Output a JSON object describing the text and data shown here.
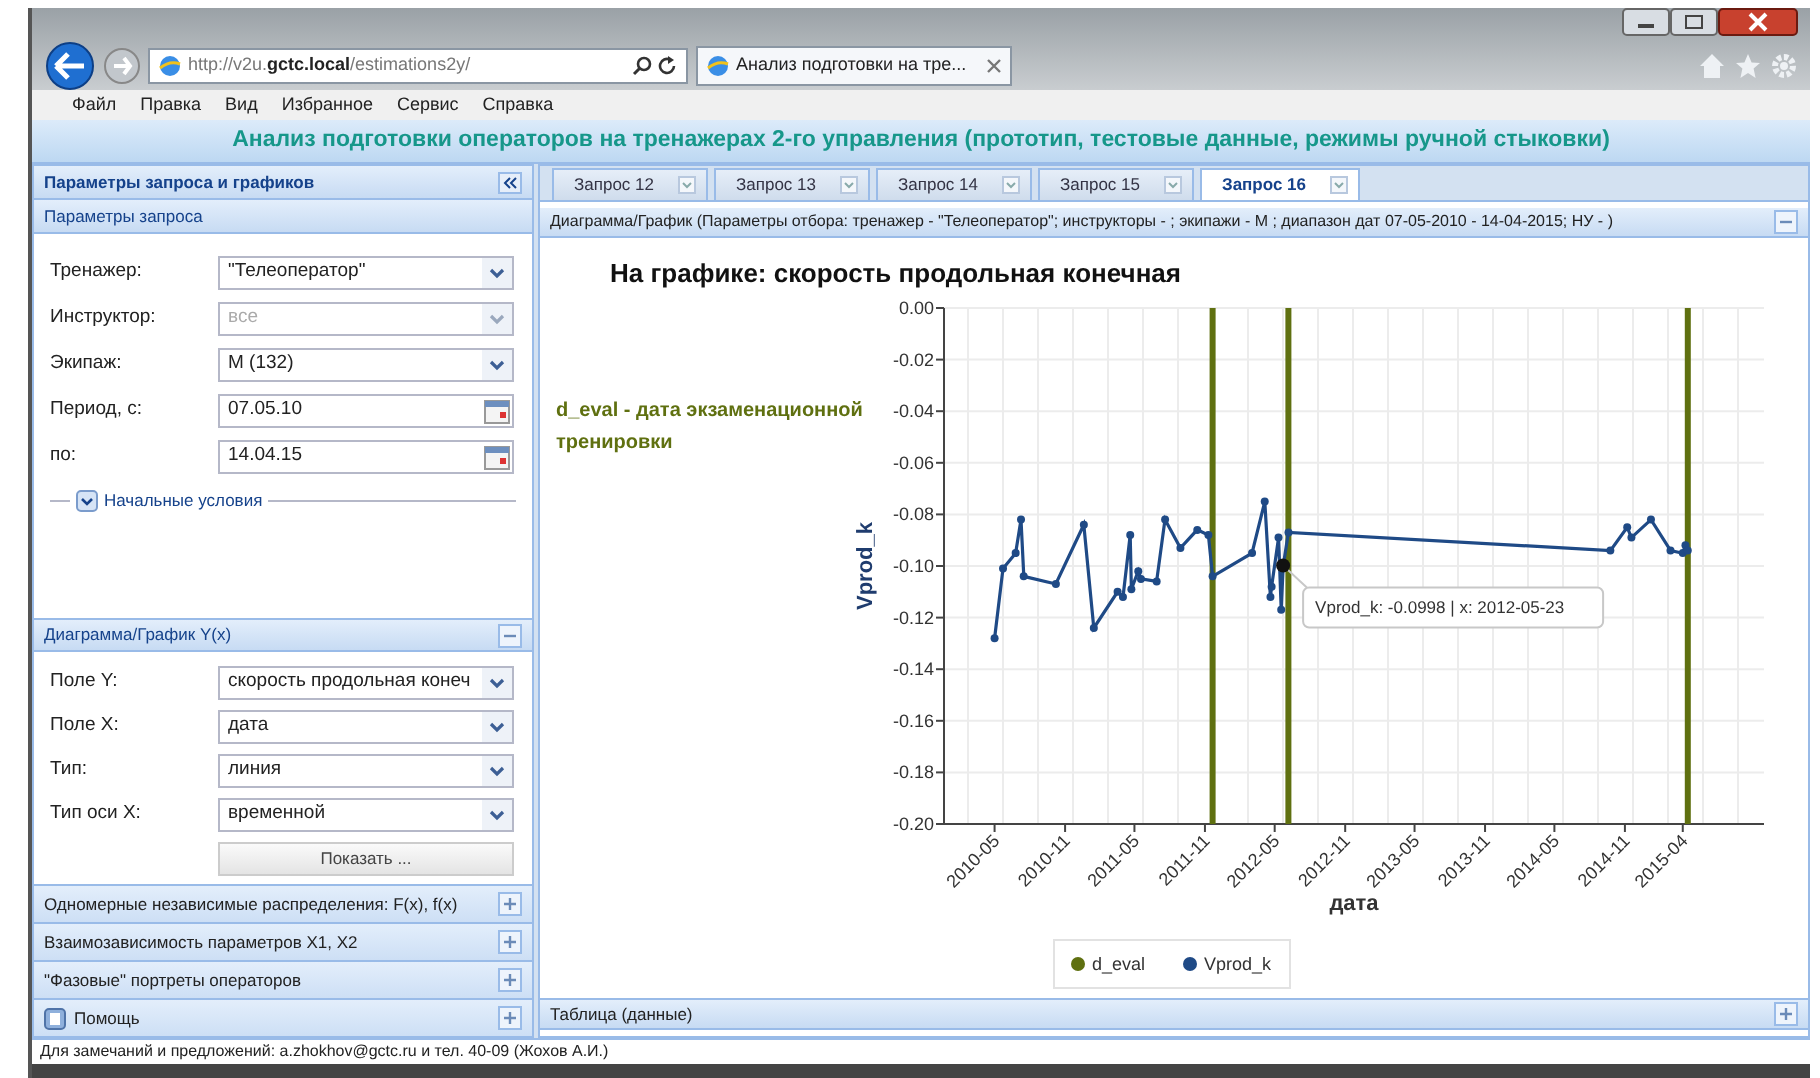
{
  "browser": {
    "address": "http://v2u.**gctc.local**/estimations2y/",
    "tab_title": "Анализ подготовки на тре...",
    "menu": [
      "Файл",
      "Правка",
      "Вид",
      "Избранное",
      "Сервис",
      "Справка"
    ]
  },
  "app_title": "Анализ подготовки операторов на тренажерах 2-го управления (прототип, тестовые данные, режимы ручной стыковки)",
  "left_panel": {
    "title": "Параметры запроса и графиков",
    "query_section": {
      "title": "Параметры запроса",
      "fields": [
        {
          "label": "Тренажер:",
          "value": "\"Телеоператор\"",
          "kind": "select",
          "disabled": false
        },
        {
          "label": "Инструктор:",
          "value": "все",
          "kind": "select",
          "disabled": true
        },
        {
          "label": "Экипаж:",
          "value": "М (132)",
          "kind": "select",
          "disabled": false
        },
        {
          "label": "Период, с:",
          "value": "07.05.10",
          "kind": "date",
          "disabled": false
        },
        {
          "label": "по:",
          "value": "14.04.15",
          "kind": "date",
          "disabled": false
        }
      ],
      "fieldset": {
        "legend": "Начальные условия",
        "expanded": false
      }
    },
    "chart_section": {
      "title": "Диаграмма/График Y(x)",
      "expanded": true,
      "fields": [
        {
          "label": "Поле Y:",
          "value": "скорость продольная конеч",
          "kind": "select",
          "disabled": false
        },
        {
          "label": "Поле X:",
          "value": "дата",
          "kind": "select",
          "disabled": false
        },
        {
          "label": "Тип:",
          "value": "линия",
          "kind": "select",
          "disabled": false
        },
        {
          "label": "Тип оси X:",
          "value": "временной",
          "kind": "select",
          "disabled": false
        }
      ],
      "button": "Показать ..."
    },
    "collapsed_panels": [
      {
        "title": "Одномерные независимые распределения: F(x), f(x)",
        "kind": "plain",
        "expanded": false
      },
      {
        "title": "Взаимозависимость параметров X1, X2",
        "kind": "plain",
        "expanded": false
      },
      {
        "title": "\"Фазовые\" портреты операторов",
        "kind": "plain",
        "expanded": false
      },
      {
        "title": "Помощь",
        "kind": "help",
        "expanded": false
      }
    ]
  },
  "tabs": [
    {
      "label": "Запрос 12",
      "selected": false
    },
    {
      "label": "Запрос 13",
      "selected": false
    },
    {
      "label": "Запрос 14",
      "selected": false
    },
    {
      "label": "Запрос 15",
      "selected": false
    },
    {
      "label": "Запрос 16",
      "selected": true
    }
  ],
  "chart_panel": {
    "title": "Диаграмма/График (Параметры отбора: тренажер - \"Телеоператор\"; инструкторы - ; экипажи - М ; диапазон дат 07-05-2010 - 14-04-2015; НУ - )",
    "expanded": true,
    "chart_title": "На графике: скорость продольная конечная",
    "note": "d_eval - дата экзаменационной тренировки",
    "chart_data": {
      "type": "line",
      "xlabel": "дата",
      "ylabel": "Vprod_k",
      "xlim": [
        "2009-12-20",
        "2015-10-30"
      ],
      "ylim": [
        -0.2,
        0
      ],
      "xticks": [
        {
          "value": "2010-05-01",
          "label": "2010-05"
        },
        {
          "value": "2010-11-01",
          "label": "2010-11"
        },
        {
          "value": "2011-05-01",
          "label": "2011-05"
        },
        {
          "value": "2011-11-01",
          "label": "2011-11"
        },
        {
          "value": "2012-05-01",
          "label": "2012-05"
        },
        {
          "value": "2012-11-01",
          "label": "2012-11"
        },
        {
          "value": "2013-05-01",
          "label": "2013-05"
        },
        {
          "value": "2013-11-01",
          "label": "2013-11"
        },
        {
          "value": "2014-05-01",
          "label": "2014-05"
        },
        {
          "value": "2014-11-01",
          "label": "2014-11"
        },
        {
          "value": "2015-04-01",
          "label": "2015-04"
        }
      ],
      "yticks": [
        {
          "value": 0,
          "label": "0.00"
        },
        {
          "value": -0.02,
          "label": "-0.02"
        },
        {
          "value": -0.04,
          "label": "-0.04"
        },
        {
          "value": -0.06,
          "label": "-0.06"
        },
        {
          "value": -0.08,
          "label": "-0.08"
        },
        {
          "value": -0.1,
          "label": "-0.10"
        },
        {
          "value": -0.12,
          "label": "-0.12"
        },
        {
          "value": -0.14,
          "label": "-0.14"
        },
        {
          "value": -0.16,
          "label": "-0.16"
        },
        {
          "value": -0.18,
          "label": "-0.18"
        },
        {
          "value": -0.2,
          "label": "-0.20"
        }
      ],
      "series": [
        {
          "name": "d_eval",
          "color": "#5f7010",
          "marker": false,
          "x": [
            "2011-11-21",
            "2011-11-21",
            null,
            "2012-06-06",
            "2012-06-06",
            null,
            "2015-04-14",
            "2015-04-14"
          ],
          "values": [
            0,
            -0.2,
            null,
            0,
            -0.2,
            null,
            0,
            -0.2
          ]
        },
        {
          "name": "Vprod_k",
          "color": "#1f4a86",
          "marker": true,
          "x": [
            "2010-05-01",
            "2010-05-23",
            "2010-06-25",
            "2010-07-09",
            "2010-07-16",
            "2010-10-08",
            "2010-12-20",
            "2011-01-15",
            "2011-03-18",
            "2011-04-01",
            "2011-04-20",
            "2011-04-23",
            "2011-05-11",
            "2011-05-18",
            "2011-06-28",
            "2011-07-20",
            "2011-08-29",
            "2011-10-12",
            "2011-11-10",
            "2011-11-21",
            "2012-03-03",
            "2012-04-05",
            "2012-04-20",
            "2012-04-23",
            "2012-05-11",
            "2012-05-18",
            "2012-05-23",
            "2012-06-06",
            "2014-09-24",
            "2014-11-07",
            "2014-11-18",
            "2015-01-08",
            "2015-02-28",
            "2015-04-01",
            "2015-04-08",
            "2015-04-14"
          ],
          "values": [
            -0.128,
            -0.101,
            -0.095,
            -0.082,
            -0.104,
            -0.107,
            -0.084,
            -0.124,
            -0.11,
            -0.112,
            -0.088,
            -0.109,
            -0.102,
            -0.105,
            -0.106,
            -0.082,
            -0.093,
            -0.086,
            -0.088,
            -0.104,
            -0.095,
            -0.075,
            -0.112,
            -0.108,
            -0.089,
            -0.117,
            -0.1,
            -0.087,
            -0.094,
            -0.085,
            -0.089,
            -0.082,
            -0.094,
            -0.095,
            -0.092,
            -0.094
          ]
        }
      ],
      "grid": true,
      "legend": "bottom",
      "annotations": [
        {
          "x": "2012-05-23",
          "y": -0.0998,
          "text": "Vprod_k: -0.0998 | x: 2012-05-23"
        }
      ]
    }
  },
  "table_panel": {
    "title": "Таблица (данные)",
    "expanded": false
  },
  "footer": "Для замечаний и предложений: a.zhokhov@gctc.ru и тел. 40-09 (Жохов А.И.)"
}
